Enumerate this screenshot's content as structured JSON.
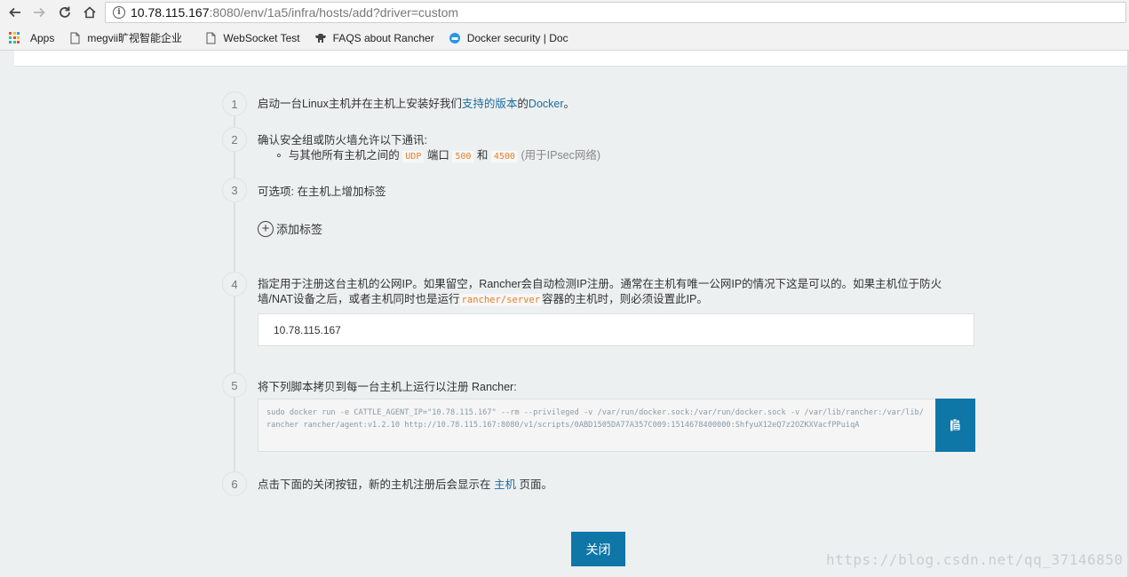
{
  "browser": {
    "url_host": "10.78.115.167",
    "url_rest": ":8080/env/1a5/infra/hosts/add?driver=custom",
    "bookmarks": [
      {
        "label": "Apps"
      },
      {
        "label": "megvii旷视智能企业"
      },
      {
        "label": "WebSocket Test"
      },
      {
        "label": "FAQS about Rancher"
      },
      {
        "label": "Docker security | Doc"
      }
    ]
  },
  "steps": [
    {
      "num": "1"
    },
    {
      "num": "2"
    },
    {
      "num": "3"
    },
    {
      "num": "4"
    },
    {
      "num": "5"
    },
    {
      "num": "6"
    }
  ],
  "step1": {
    "pre": "启动一台Linux主机并在主机上安装好我们",
    "link": "支持的版本",
    "mid": "的",
    "link2": "Docker",
    "post": "。"
  },
  "step2": {
    "title": "确认安全组或防火墙允许以下通讯:",
    "bullet_pre": "与其他所有主机之间的",
    "udp": "UDP",
    "port_text": "端口",
    "p1": "500",
    "and": "和",
    "p2": "4500",
    "note": "(用于IPsec网络)"
  },
  "step3": {
    "title": "可选项: 在主机上增加标签",
    "add_label": "添加标签"
  },
  "step4": {
    "line1": "指定用于注册这台主机的公网IP。如果留空，Rancher会自动检测IP注册。通常在主机有唯一公网IP的情况下这是可以的。如果主机位于防火",
    "line2_pre": "墙/NAT设备之后，或者主机同时也是运行",
    "code": "rancher/server",
    "line2_post": "容器的主机时，则必须设置此IP。",
    "ip_value": "10.78.115.167"
  },
  "step5": {
    "title": "将下列脚本拷贝到每一台主机上运行以注册 Rancher:",
    "command": "sudo docker run -e CATTLE_AGENT_IP=\"10.78.115.167\"  --rm --privileged -v /var/run/docker.sock:/var/run/docker.sock -v /var/lib/rancher:/var/lib/rancher rancher/agent:v1.2.10 http://10.78.115.167:8080/v1/scripts/0ABD1505DA77A357C009:1514678400000:ShfyuX12eQ7z2OZKXVacfPPuiqA"
  },
  "step6": {
    "pre": "点击下面的关闭按钮，新的主机注册后会显示在",
    "link": "主机",
    "post": "页面。"
  },
  "close_label": "关闭",
  "watermark": "https://blog.csdn.net/qq_37146850",
  "colors": {
    "accent": "#0f76a8",
    "link": "#1f6b9c",
    "code": "#e67e22",
    "background": "#ecf0f1"
  }
}
